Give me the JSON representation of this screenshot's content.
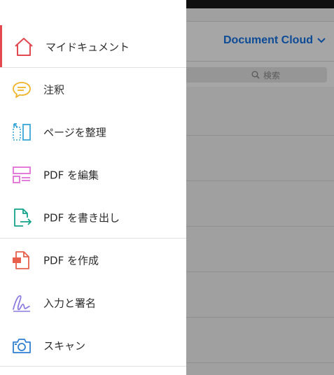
{
  "background": {
    "title": "Document Cloud",
    "search_placeholder": "検索"
  },
  "menu": {
    "items": [
      {
        "label": "マイドキュメント",
        "icon": "home-icon",
        "color": "#e34850",
        "active": true
      },
      {
        "label": "注釈",
        "icon": "comment-icon",
        "color": "#f0b429"
      },
      {
        "label": "ページを整理",
        "icon": "organize-pages-icon",
        "color": "#3aa6d8"
      },
      {
        "label": "PDF を編集",
        "icon": "edit-pdf-icon",
        "color": "#e26fd6"
      },
      {
        "label": "PDF を書き出し",
        "icon": "export-pdf-icon",
        "color": "#14a38b"
      },
      {
        "label": "PDF を作成",
        "icon": "create-pdf-icon",
        "color": "#e8604c"
      },
      {
        "label": "入力と署名",
        "icon": "fill-sign-icon",
        "color": "#8c7be0"
      },
      {
        "label": "スキャン",
        "icon": "camera-icon",
        "color": "#2f7fd2"
      }
    ]
  }
}
